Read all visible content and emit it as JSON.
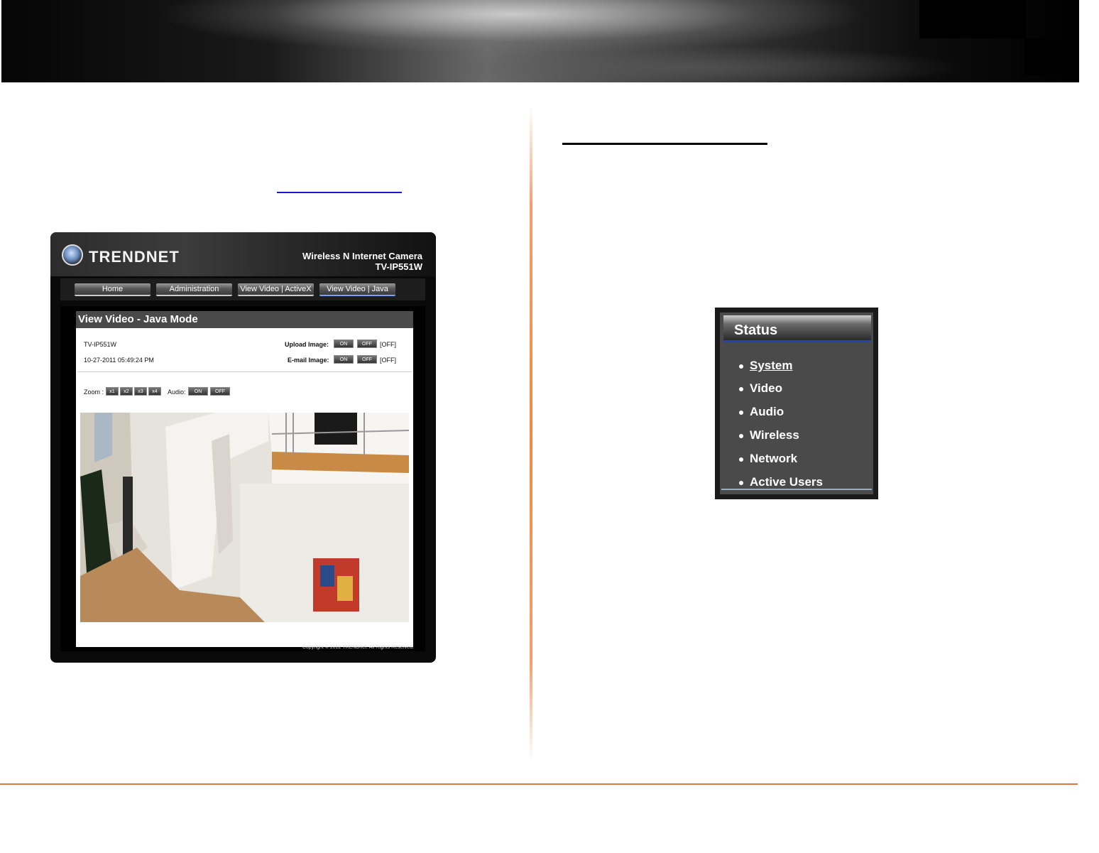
{
  "camera_ui": {
    "logo_text": "TRENDNET",
    "product_line": "Wireless N Internet Camera",
    "model": "TV-IP551W",
    "nav": [
      "Home",
      "Administration",
      "View Video | ActiveX",
      "View Video | Java"
    ],
    "panel_title": "View Video - Java Mode",
    "device_name": "TV-IP551W",
    "datetime": "10-27-2011 05:49:24 PM",
    "upload_label": "Upload Image:",
    "email_label": "E-mail Image:",
    "on_label": "ON",
    "off_label": "OFF",
    "state_label": "[OFF]",
    "zoom_label": "Zoom :",
    "zoom_levels": [
      "x1",
      "x2",
      "x3",
      "x4"
    ],
    "audio_label": "Audio:",
    "copyright": "Copyright © 2012 TRENDnet. All Rights Reserved."
  },
  "status_menu": {
    "title": "Status",
    "items": [
      "System",
      "Video",
      "Audio",
      "Wireless",
      "Network",
      "Active Users"
    ]
  }
}
